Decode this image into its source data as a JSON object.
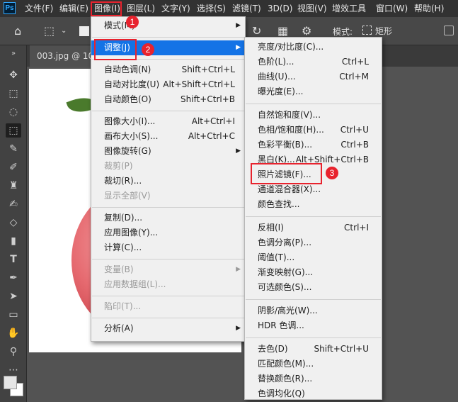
{
  "app": {
    "logo": "Ps"
  },
  "menubar": {
    "items": [
      "文件(F)",
      "编辑(E)",
      "图像(I)",
      "图层(L)",
      "文字(Y)",
      "选择(S)",
      "滤镜(T)",
      "3D(D)",
      "视图(V)",
      "增效工具",
      "窗口(W)",
      "帮助(H)"
    ]
  },
  "options": {
    "mode_label": "模式:",
    "mode_value": "矩形"
  },
  "document": {
    "tab_title": "003.jpg @ 10"
  },
  "image_menu": [
    {
      "label": "模式(M)",
      "submenu": true
    },
    {
      "sep": true
    },
    {
      "label": "调整(J)",
      "submenu": true,
      "highlight": true
    },
    {
      "sep": true
    },
    {
      "label": "自动色调(N)",
      "shortcut": "Shift+Ctrl+L"
    },
    {
      "label": "自动对比度(U)",
      "shortcut": "Alt+Shift+Ctrl+L"
    },
    {
      "label": "自动颜色(O)",
      "shortcut": "Shift+Ctrl+B"
    },
    {
      "sep": true
    },
    {
      "label": "图像大小(I)...",
      "shortcut": "Alt+Ctrl+I"
    },
    {
      "label": "画布大小(S)...",
      "shortcut": "Alt+Ctrl+C"
    },
    {
      "label": "图像旋转(G)",
      "submenu": true
    },
    {
      "label": "裁剪(P)",
      "disabled": true
    },
    {
      "label": "裁切(R)..."
    },
    {
      "label": "显示全部(V)",
      "disabled": true
    },
    {
      "sep": true
    },
    {
      "label": "复制(D)..."
    },
    {
      "label": "应用图像(Y)..."
    },
    {
      "label": "计算(C)..."
    },
    {
      "sep": true
    },
    {
      "label": "变量(B)",
      "submenu": true,
      "disabled": true
    },
    {
      "label": "应用数据组(L)...",
      "disabled": true
    },
    {
      "sep": true
    },
    {
      "label": "陷印(T)...",
      "disabled": true
    },
    {
      "sep": true
    },
    {
      "label": "分析(A)",
      "submenu": true
    }
  ],
  "adjust_menu": [
    {
      "label": "亮度/对比度(C)..."
    },
    {
      "label": "色阶(L)...",
      "shortcut": "Ctrl+L"
    },
    {
      "label": "曲线(U)...",
      "shortcut": "Ctrl+M"
    },
    {
      "label": "曝光度(E)..."
    },
    {
      "sep": true
    },
    {
      "label": "自然饱和度(V)..."
    },
    {
      "label": "色相/饱和度(H)...",
      "shortcut": "Ctrl+U"
    },
    {
      "label": "色彩平衡(B)...",
      "shortcut": "Ctrl+B"
    },
    {
      "label": "黑白(K)...",
      "shortcut": "Alt+Shift+Ctrl+B"
    },
    {
      "label": "照片滤镜(F)..."
    },
    {
      "label": "通道混合器(X)..."
    },
    {
      "label": "颜色查找..."
    },
    {
      "sep": true
    },
    {
      "label": "反相(I)",
      "shortcut": "Ctrl+I"
    },
    {
      "label": "色调分离(P)..."
    },
    {
      "label": "阈值(T)..."
    },
    {
      "label": "渐变映射(G)..."
    },
    {
      "label": "可选颜色(S)..."
    },
    {
      "sep": true
    },
    {
      "label": "阴影/高光(W)..."
    },
    {
      "label": "HDR 色调..."
    },
    {
      "sep": true
    },
    {
      "label": "去色(D)",
      "shortcut": "Shift+Ctrl+U"
    },
    {
      "label": "匹配颜色(M)..."
    },
    {
      "label": "替换颜色(R)..."
    },
    {
      "label": "色调均化(Q)"
    }
  ],
  "badges": [
    "1",
    "2",
    "3"
  ],
  "colors": {
    "highlight": "#1473e6",
    "annotation": "#e8232e"
  }
}
